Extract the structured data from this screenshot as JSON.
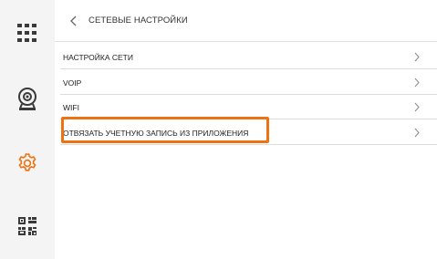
{
  "sidebar": {
    "items": [
      {
        "icon": "grid-icon",
        "active": false
      },
      {
        "icon": "camera-icon",
        "active": false
      },
      {
        "icon": "gear-icon",
        "active": true
      },
      {
        "icon": "qr-code-icon",
        "active": false
      }
    ]
  },
  "header": {
    "title": "СЕТЕВЫЕ НАСТРОЙКИ",
    "back_icon": "chevron-left-icon"
  },
  "menu": {
    "items": [
      {
        "label": "НАСТРОЙКА СЕТИ"
      },
      {
        "label": "VOIP"
      },
      {
        "label": "WIFI"
      },
      {
        "label": "ОТВЯЗАТЬ УЧЕТНУЮ ЗАПИСЬ ИЗ ПРИЛОЖЕНИЯ"
      }
    ],
    "chevron_icon": "chevron-right-icon"
  },
  "colors": {
    "accent": "#ed7212",
    "sidebar_bg": "#f4f4f4",
    "icon_dark": "#3a3a3a"
  }
}
